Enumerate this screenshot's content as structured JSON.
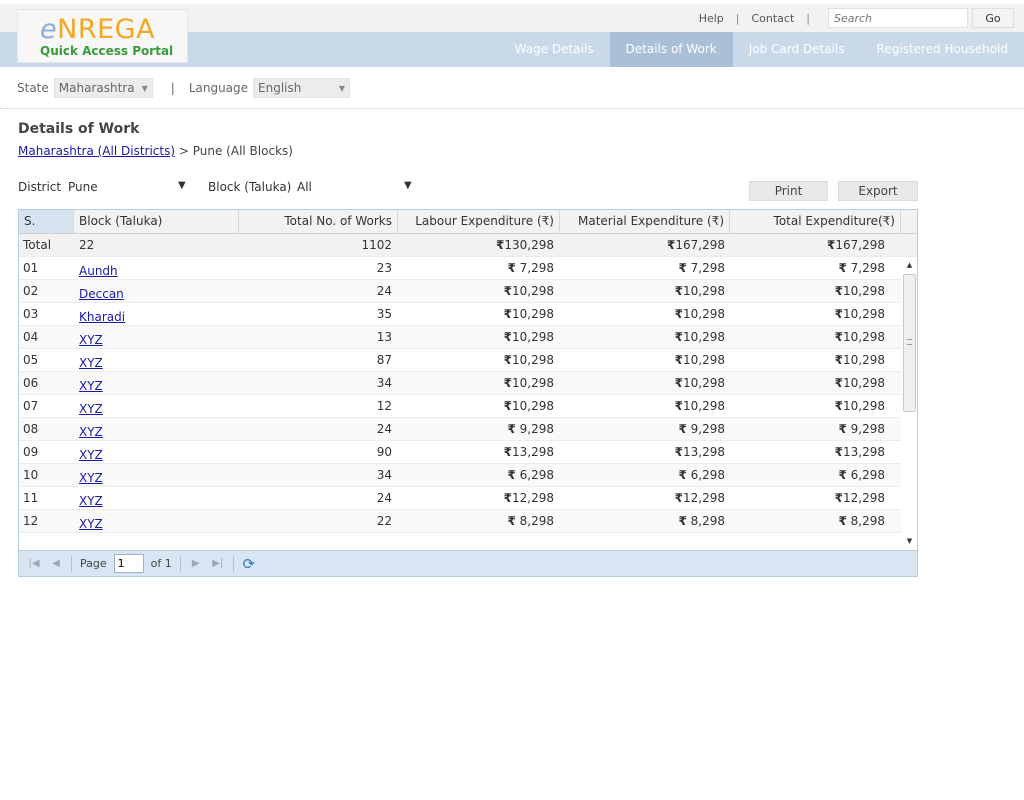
{
  "brand": {
    "title_e": "e",
    "title_rest": "NREGA",
    "subtitle": "Quick Access Portal"
  },
  "toplinks": {
    "help": "Help",
    "contact": "Contact",
    "search_placeholder": "Search",
    "go": "Go"
  },
  "nav": {
    "tabs": [
      {
        "label": "Wage Details"
      },
      {
        "label": "Details of Work"
      },
      {
        "label": "Job Card Details"
      },
      {
        "label": "Registered Household"
      }
    ],
    "active": "Details of Work"
  },
  "filters": {
    "state_label": "State",
    "state_value": "Maharashtra",
    "language_label": "Language",
    "language_value": "English",
    "separator": "|"
  },
  "page": {
    "title": "Details of Work",
    "crumb_link": "Maharashtra (All Districts)",
    "crumb_sep": ">",
    "crumb_current": "Pune (All Blocks)"
  },
  "selectors": {
    "district_label": "District",
    "district_value": "Pune",
    "block_label": "Block (Taluka)",
    "block_value": "All"
  },
  "actions": {
    "print": "Print",
    "export": "Export"
  },
  "grid": {
    "headers": {
      "sno": "S. No.",
      "block": "Block (Taluka)",
      "works": "Total No. of Works",
      "labour": "Labour Expenditure (₹)",
      "material": "Material Expenditure (₹)",
      "total": "Total Expenditure(₹)"
    },
    "currency": "₹",
    "total_row": {
      "label": "Total",
      "block": "22",
      "works": "1102",
      "labour": "130,298",
      "material": "167,298",
      "total": "167,298"
    },
    "rows": [
      {
        "sno": "01",
        "block": "Aundh",
        "works": "23",
        "labour": " 7,298",
        "material": " 7,298",
        "total": " 7,298"
      },
      {
        "sno": "02",
        "block": "Deccan",
        "works": "24",
        "labour": "10,298",
        "material": "10,298",
        "total": "10,298"
      },
      {
        "sno": "03",
        "block": "Kharadi",
        "works": "35",
        "labour": "10,298",
        "material": "10,298",
        "total": "10,298"
      },
      {
        "sno": "04",
        "block": "XYZ",
        "works": "13",
        "labour": "10,298",
        "material": "10,298",
        "total": "10,298"
      },
      {
        "sno": "05",
        "block": "XYZ",
        "works": "87",
        "labour": "10,298",
        "material": "10,298",
        "total": "10,298"
      },
      {
        "sno": "06",
        "block": "XYZ",
        "works": "34",
        "labour": "10,298",
        "material": "10,298",
        "total": "10,298"
      },
      {
        "sno": "07",
        "block": "XYZ",
        "works": "12",
        "labour": "10,298",
        "material": "10,298",
        "total": "10,298"
      },
      {
        "sno": "08",
        "block": "XYZ",
        "works": "24",
        "labour": " 9,298",
        "material": " 9,298",
        "total": " 9,298"
      },
      {
        "sno": "09",
        "block": "XYZ",
        "works": "90",
        "labour": "13,298",
        "material": "13,298",
        "total": "13,298"
      },
      {
        "sno": "10",
        "block": "XYZ",
        "works": "34",
        "labour": " 6,298",
        "material": " 6,298",
        "total": " 6,298"
      },
      {
        "sno": "11",
        "block": "XYZ",
        "works": "24",
        "labour": "12,298",
        "material": "12,298",
        "total": "12,298"
      },
      {
        "sno": "12",
        "block": "XYZ",
        "works": "22",
        "labour": " 8,298",
        "material": " 8,298",
        "total": " 8,298"
      }
    ]
  },
  "pager": {
    "page_label": "Page",
    "page_value": "1",
    "of_label": "of 1"
  },
  "icons": {
    "dropdown": "triangle-down-icon",
    "sort": "sort-ascending-icon",
    "first": "first-page-icon",
    "prev": "prev-page-icon",
    "next": "next-page-icon",
    "last": "last-page-icon",
    "refresh": "refresh-icon",
    "scroll_up": "scroll-up-icon",
    "scroll_down": "scroll-down-icon"
  },
  "colors": {
    "nav_bg": "#c9d9e9",
    "nav_active": "#a9c0d8",
    "link": "#1a1aa6",
    "brand_orange": "#f5a623",
    "brand_green": "#3a9a3a",
    "pager_bg": "#d8e6f3"
  }
}
